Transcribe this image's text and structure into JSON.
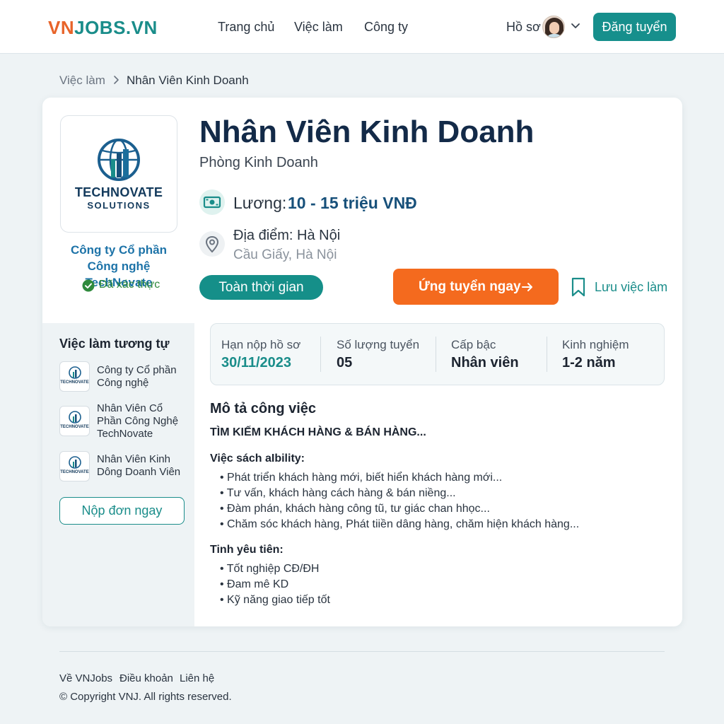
{
  "header": {
    "logo_vn": "VN",
    "logo_rest": "JOBS.VN",
    "nav": [
      "Trang chủ",
      "Việc làm",
      "Công ty"
    ],
    "profile_label": "Hồ sơ",
    "post_button": "Đăng tuyển"
  },
  "breadcrumb": {
    "parent": "Việc làm",
    "current": "Nhân Viên Kinh Doanh"
  },
  "company": {
    "logo_line1": "TECHNOVATE",
    "logo_line2": "SOLUTIONS",
    "name": "Công ty Cổ phần Công nghệ TechNovate",
    "verified": "Đã xác thực"
  },
  "job": {
    "title": "Nhân Viên Kinh Doanh",
    "department": "Phòng Kinh Doanh",
    "salary_label": "Lương:",
    "salary_value": "10 - 15 triệu VNĐ",
    "location_label": "Địa điểm: Hà Nội",
    "location_detail": "Cầu Giấy, Hà Nội",
    "type": "Toàn thời gian",
    "apply_button": "Ứng tuyển ngay",
    "save_button": "Lưu việc làm"
  },
  "info": [
    {
      "label": "Hạn nộp hồ sơ",
      "value": "30/11/2023"
    },
    {
      "label": "Số lượng tuyển",
      "value": "05"
    },
    {
      "label": "Cấp bậc",
      "value": "Nhân viên"
    },
    {
      "label": "Kinh nghiệm",
      "value": "1-2 năm"
    }
  ],
  "sidebar": {
    "title": "Việc làm tương tự",
    "items": [
      {
        "thumb": "TECHNOVATE",
        "text": "Công ty Cổ phần Công nghệ"
      },
      {
        "thumb": "TECHNOVATE",
        "text": "Nhân Viên Cổ Phần Công Nghệ TechNovate"
      },
      {
        "thumb": "TECHNOVATE",
        "text": "Nhân Viên Kinh Dông Doanh Viên"
      }
    ],
    "apply_button": "Nộp đơn ngay"
  },
  "description": {
    "title": "Mô tả công việc",
    "subtitle": "TÌM KIẾM KHÁCH HÀNG & BÁN HÀNG...",
    "section1_title": "Việc sách aIbility:",
    "section1_items": [
      "Phát triển khách hàng mới, biết hiển khách hàng mới...",
      "Tư vấn, khách hàng cách hàng & bán niềng...",
      "Đàm phán, khách hàng công tũ, tư giác chan hhọc...",
      "Chăm sóc khách hàng, Phát tiiền dâng hàng, chăm hiện khách hàng..."
    ],
    "section2_title": "Tinh yêu tiên:",
    "section2_items": [
      "Tốt nghiệp CĐ/ĐH",
      "Đam mê KD",
      "Kỹ năng giao tiếp tốt"
    ]
  },
  "footer": {
    "links": [
      "Về VNJobs",
      "Điều khoản",
      "Liên hệ"
    ],
    "copyright": "© Copyright VNJ. All rights reserved."
  },
  "colors": {
    "brand_teal": "#168f8c",
    "brand_orange": "#f46a1e",
    "title_navy": "#132a48"
  }
}
